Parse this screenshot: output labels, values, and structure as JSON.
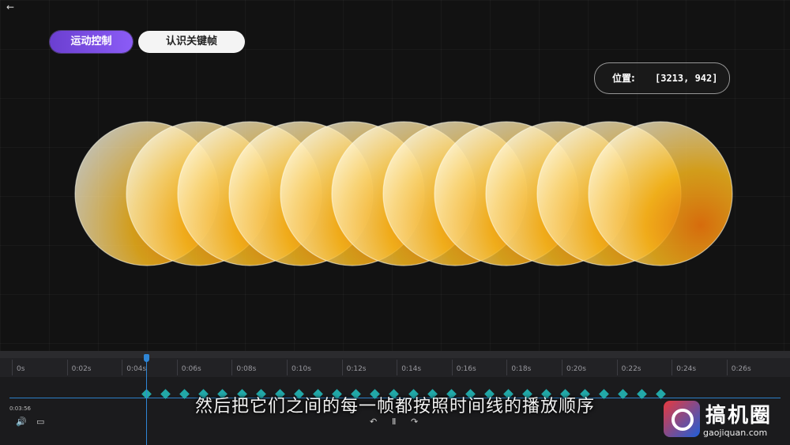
{
  "header": {
    "tabs": [
      {
        "label": "运动控制",
        "active": true
      },
      {
        "label": "认识关键帧",
        "active": false
      }
    ],
    "position_label": "位置:",
    "position_value": "[3213, 942]"
  },
  "stage": {
    "circle_count": 11,
    "colors": {
      "light": "#fff4c8",
      "mid": "#f5c21a",
      "deep": "#e87a10",
      "edge": "#f0f0e0"
    }
  },
  "timeline": {
    "ruler_labels": [
      "0s",
      "0:02s",
      "0:04s",
      "0:06s",
      "0:08s",
      "0:10s",
      "0:12s",
      "0:14s",
      "0:16s",
      "0:18s",
      "0:20s",
      "0:22s",
      "0:24s",
      "0:26s"
    ],
    "timecode": "0:03:56",
    "keyframe_count": 28,
    "accent": "#2f86d6",
    "keyframe_color": "#22a8a8",
    "controls": {
      "volume_icon": "🔊",
      "caption_icon": "▭",
      "prev_icon": "↶",
      "pause_icon": "Ⅱ",
      "next_icon": "↷"
    }
  },
  "subtitle": "然后把它们之间的每一帧都按照时间线的播放顺序",
  "watermark": {
    "brand": "搞机圈",
    "url": "gaojiquan.com"
  }
}
